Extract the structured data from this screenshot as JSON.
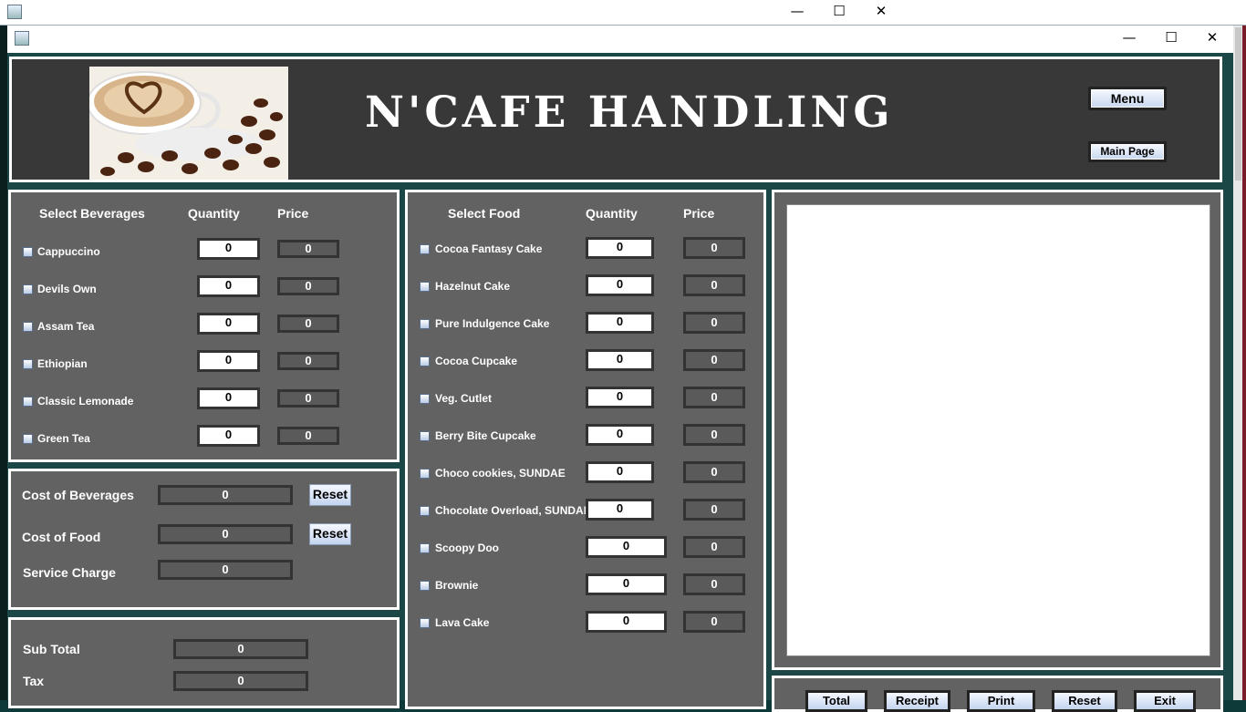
{
  "window": {
    "minimize": "—",
    "maximize": "☐",
    "close": "✕"
  },
  "header": {
    "title": "N'Cafe Handling",
    "menu_button": "Menu",
    "main_page_button": "Main Page",
    "logo": "coffee-cup-logo"
  },
  "beverages": {
    "col_item": "Select Beverages",
    "col_qty": "Quantity",
    "col_price": "Price",
    "items": [
      {
        "name": "Cappuccino",
        "qty": "0",
        "price": "0"
      },
      {
        "name": "Devils Own",
        "qty": "0",
        "price": "0"
      },
      {
        "name": "Assam Tea",
        "qty": "0",
        "price": "0"
      },
      {
        "name": "Ethiopian",
        "qty": "0",
        "price": "0"
      },
      {
        "name": "Classic Lemonade",
        "qty": "0",
        "price": "0"
      },
      {
        "name": "Green Tea",
        "qty": "0",
        "price": "0"
      }
    ]
  },
  "costs": {
    "beverages_label": "Cost of Beverages",
    "beverages_value": "0",
    "food_label": "Cost of Food",
    "food_value": "0",
    "service_label": "Service Charge",
    "service_value": "0",
    "reset_label": "Reset"
  },
  "totals": {
    "subtotal_label": "Sub Total",
    "subtotal_value": "0",
    "tax_label": "Tax",
    "tax_value": "0"
  },
  "food": {
    "col_item": "Select Food",
    "col_qty": "Quantity",
    "col_price": "Price",
    "items": [
      {
        "name": "Cocoa Fantasy Cake",
        "qty": "0",
        "price": "0"
      },
      {
        "name": "Hazelnut Cake",
        "qty": "0",
        "price": "0"
      },
      {
        "name": "Pure Indulgence Cake",
        "qty": "0",
        "price": "0"
      },
      {
        "name": "Cocoa Cupcake",
        "qty": "0",
        "price": "0"
      },
      {
        "name": "Veg. Cutlet",
        "qty": "0",
        "price": "0"
      },
      {
        "name": "Berry Bite Cupcake",
        "qty": "0",
        "price": "0"
      },
      {
        "name": "Choco cookies, SUNDAE",
        "qty": "0",
        "price": "0"
      },
      {
        "name": "Chocolate Overload, SUNDAE",
        "qty": "0",
        "price": "0"
      },
      {
        "name": "Scoopy Doo",
        "qty": "0",
        "price": "0"
      },
      {
        "name": "Brownie",
        "qty": "0",
        "price": "0"
      },
      {
        "name": "Lava Cake",
        "qty": "0",
        "price": "0"
      }
    ]
  },
  "actions": {
    "total": "Total",
    "receipt": "Receipt",
    "print": "Print",
    "reset": "Reset",
    "exit": "Exit"
  }
}
